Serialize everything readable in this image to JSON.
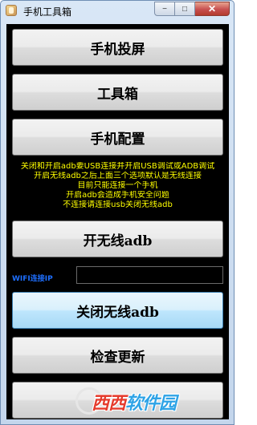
{
  "window": {
    "title": "手机工具箱",
    "minimize_glyph": "−",
    "maximize_glyph": "□",
    "close_glyph": "✕"
  },
  "buttons": {
    "screen_mirror": "手机投屏",
    "toolbox": "工具箱",
    "phone_config": "手机配置",
    "enable_wireless_adb": "开无线adb",
    "disable_wireless_adb": "关闭无线adb",
    "check_update": "检查更新",
    "bottom_button": ""
  },
  "info_lines": [
    "关闭和开启adb要USB连接并开启USB调试或ADB调试",
    "开启无线adb之后上面三个选项默认是无线连接",
    "目前只能连接一个手机",
    "开启adb会造成手机安全问题",
    "不连接请连接usb关闭无线adb"
  ],
  "wifi": {
    "label": "WIFI连接IP",
    "value": ""
  },
  "watermark": {
    "brand_red": "西西",
    "brand_blue": "软件园",
    "colors": {
      "red": "#e53b2c",
      "blue": "#2ea3e6"
    }
  },
  "colors": {
    "info_text": "#ffff00",
    "wifi_label": "#1e6fff",
    "client_background": "#000000"
  }
}
